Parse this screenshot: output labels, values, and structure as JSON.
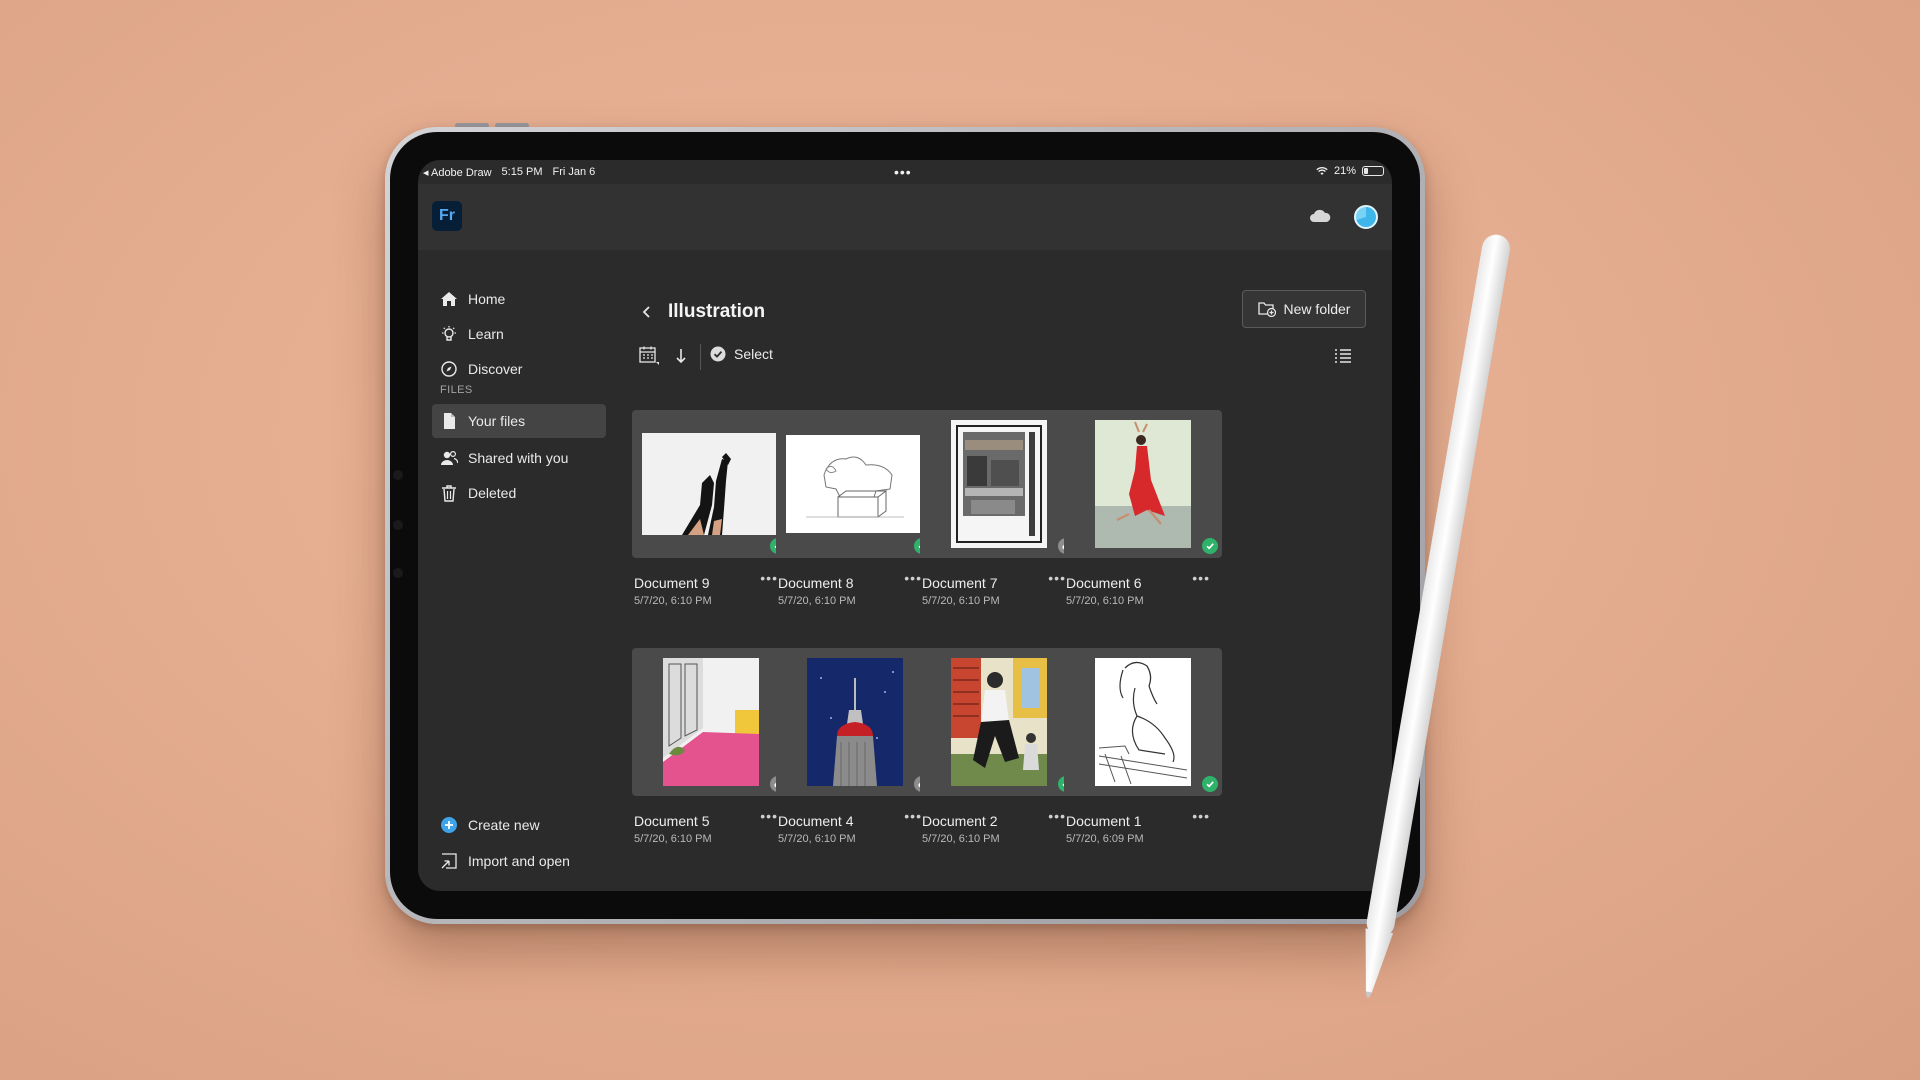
{
  "status_bar": {
    "back_app": "Adobe Draw",
    "time": "5:15 PM",
    "date": "Fri Jan 6",
    "battery": "21%"
  },
  "app": {
    "logo_text": "Fr"
  },
  "sidebar": {
    "nav": [
      {
        "label": "Home"
      },
      {
        "label": "Learn"
      },
      {
        "label": "Discover"
      }
    ],
    "files_heading": "FILES",
    "files": [
      {
        "label": "Your files"
      },
      {
        "label": "Shared with you"
      },
      {
        "label": "Deleted"
      }
    ],
    "actions": [
      {
        "label": "Create new"
      },
      {
        "label": "Import and open"
      }
    ]
  },
  "main": {
    "title": "Illustration",
    "new_folder_label": "New folder",
    "select_label": "Select",
    "documents": [
      {
        "name": "Document 9",
        "date": "5/7/20, 6:10 PM",
        "status": "synced"
      },
      {
        "name": "Document 8",
        "date": "5/7/20, 6:10 PM",
        "status": "synced"
      },
      {
        "name": "Document 7",
        "date": "5/7/20, 6:10 PM",
        "status": "cloud"
      },
      {
        "name": "Document 6",
        "date": "5/7/20, 6:10 PM",
        "status": "synced"
      },
      {
        "name": "Document 5",
        "date": "5/7/20, 6:10 PM",
        "status": "cloud"
      },
      {
        "name": "Document 4",
        "date": "5/7/20, 6:10 PM",
        "status": "cloud"
      },
      {
        "name": "Document 2",
        "date": "5/7/20, 6:10 PM",
        "status": "synced"
      },
      {
        "name": "Document 1",
        "date": "5/7/20, 6:09 PM",
        "status": "synced"
      }
    ]
  },
  "colors": {
    "accent": "#2fb26a",
    "brand": "#56a9f3",
    "create_new_icon": "#3fa3e8"
  }
}
